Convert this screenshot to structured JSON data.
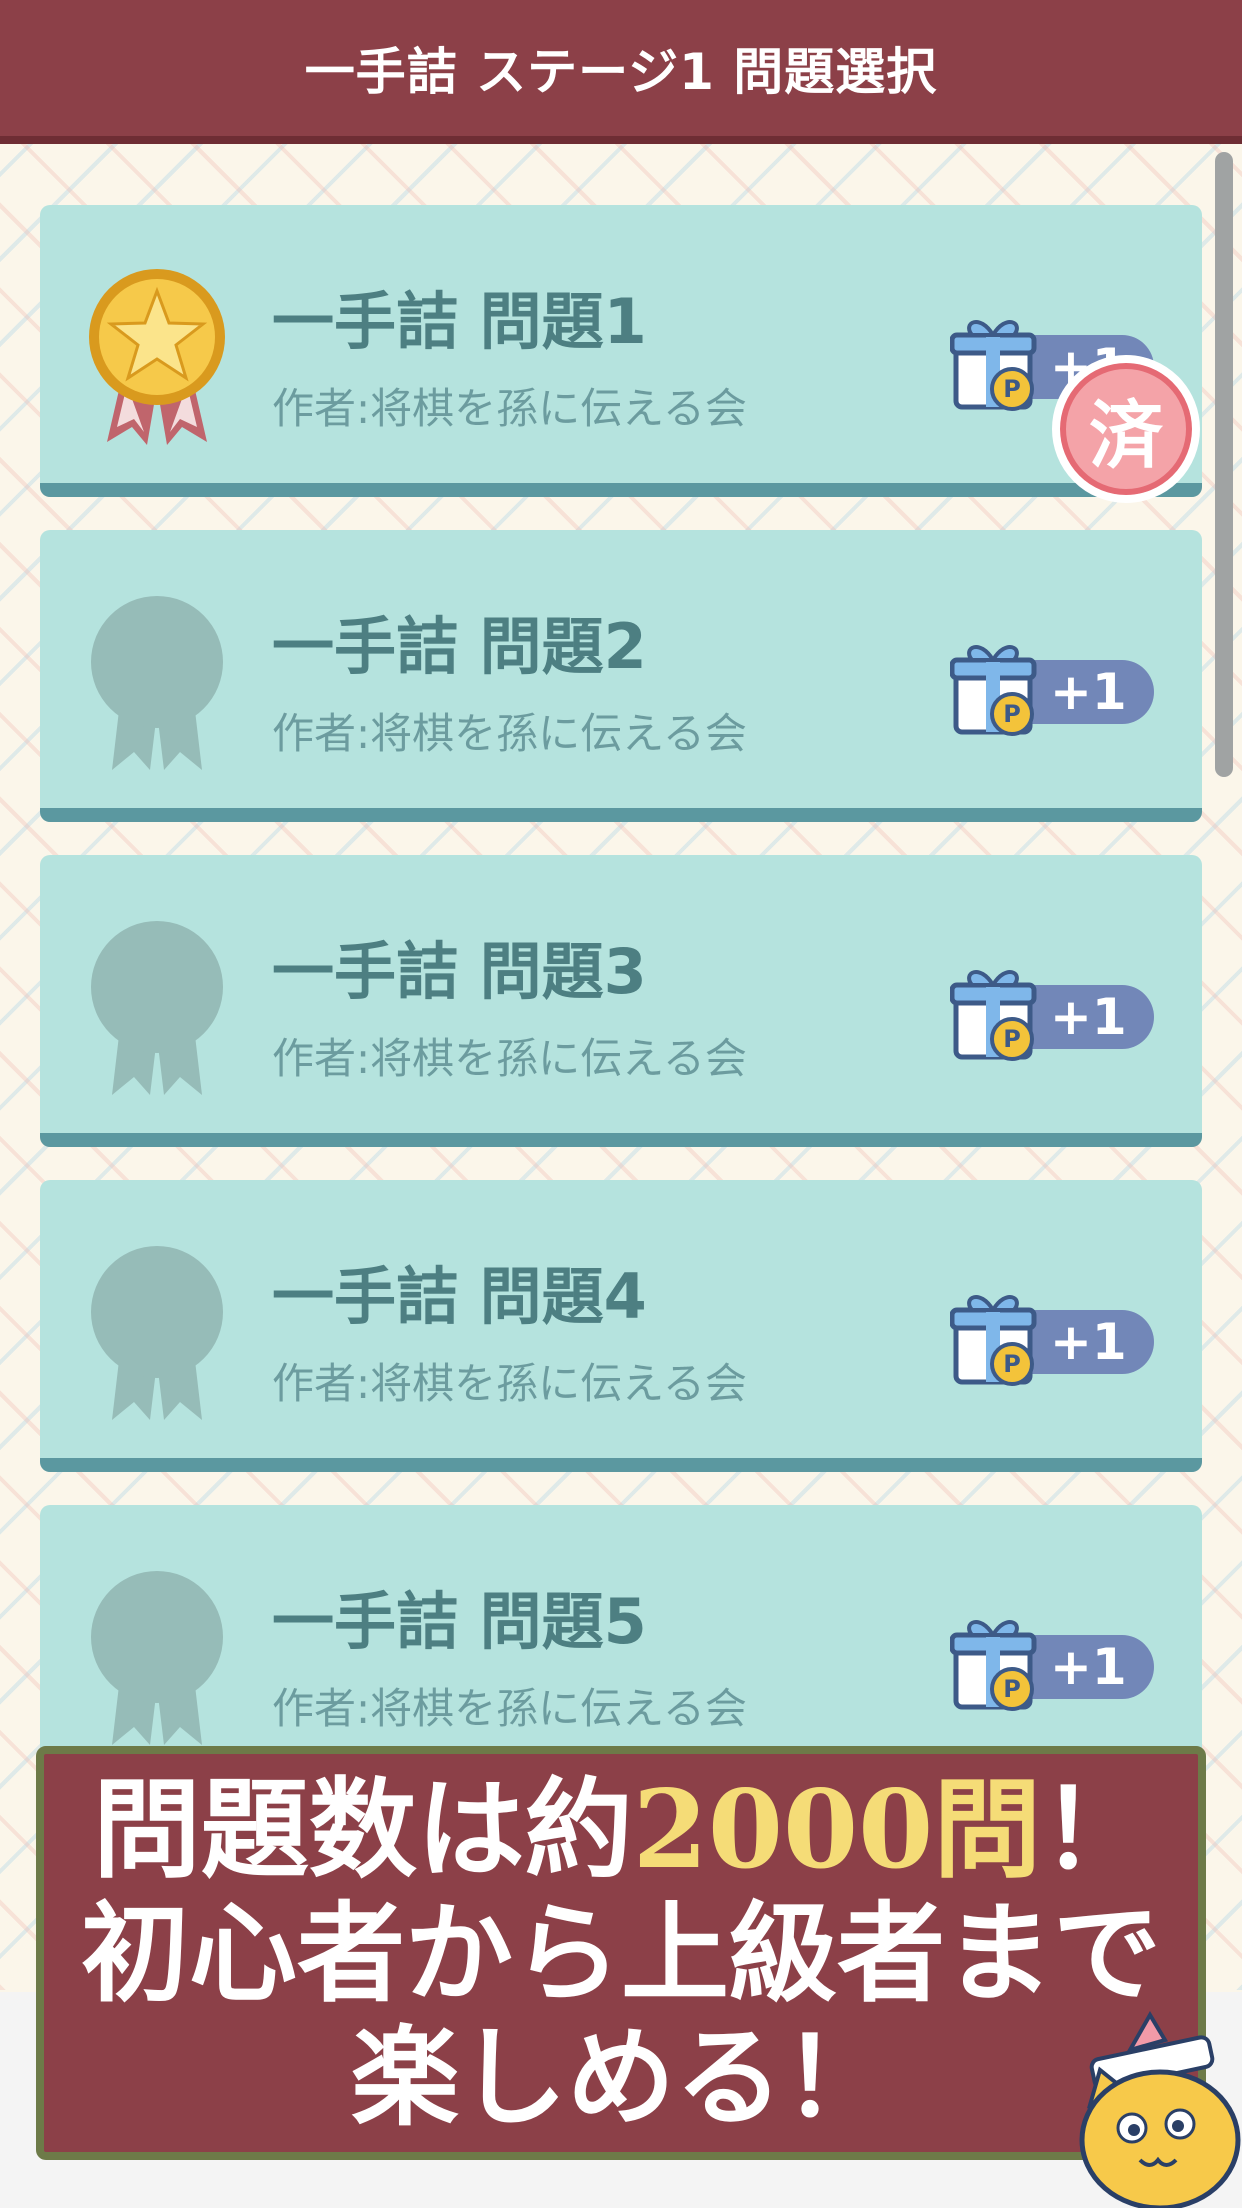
{
  "header": {
    "title": "一手詰 ステージ1 問題選択"
  },
  "problems": [
    {
      "title": "一手詰 問題1",
      "author": "作者:将棋を孫に伝える会",
      "reward": "+1",
      "medal": "gold",
      "completed": true,
      "completed_label": "済"
    },
    {
      "title": "一手詰 問題2",
      "author": "作者:将棋を孫に伝える会",
      "reward": "+1",
      "medal": "none",
      "completed": false
    },
    {
      "title": "一手詰 問題3",
      "author": "作者:将棋を孫に伝える会",
      "reward": "+1",
      "medal": "none",
      "completed": false
    },
    {
      "title": "一手詰 問題4",
      "author": "作者:将棋を孫に伝える会",
      "reward": "+1",
      "medal": "none",
      "completed": false
    },
    {
      "title": "一手詰 問題5",
      "author": "作者:将棋を孫に伝える会",
      "reward": "+1",
      "medal": "none",
      "completed": false
    }
  ],
  "banner": {
    "line1_prefix": "問題数は約",
    "line1_highlight": "2000問",
    "line1_suffix": "！",
    "line2": "初心者から上級者まで",
    "line3": "楽しめる！"
  },
  "icons": {
    "reward": "gift-point-icon",
    "medal": "medal-icon",
    "mascot": "cat-mascot"
  },
  "colors": {
    "header": "#8c4048",
    "card": "#b5e3de",
    "card_border": "#5b98a0",
    "highlight": "#f5dc77",
    "reward_pill": "#7287b8"
  }
}
